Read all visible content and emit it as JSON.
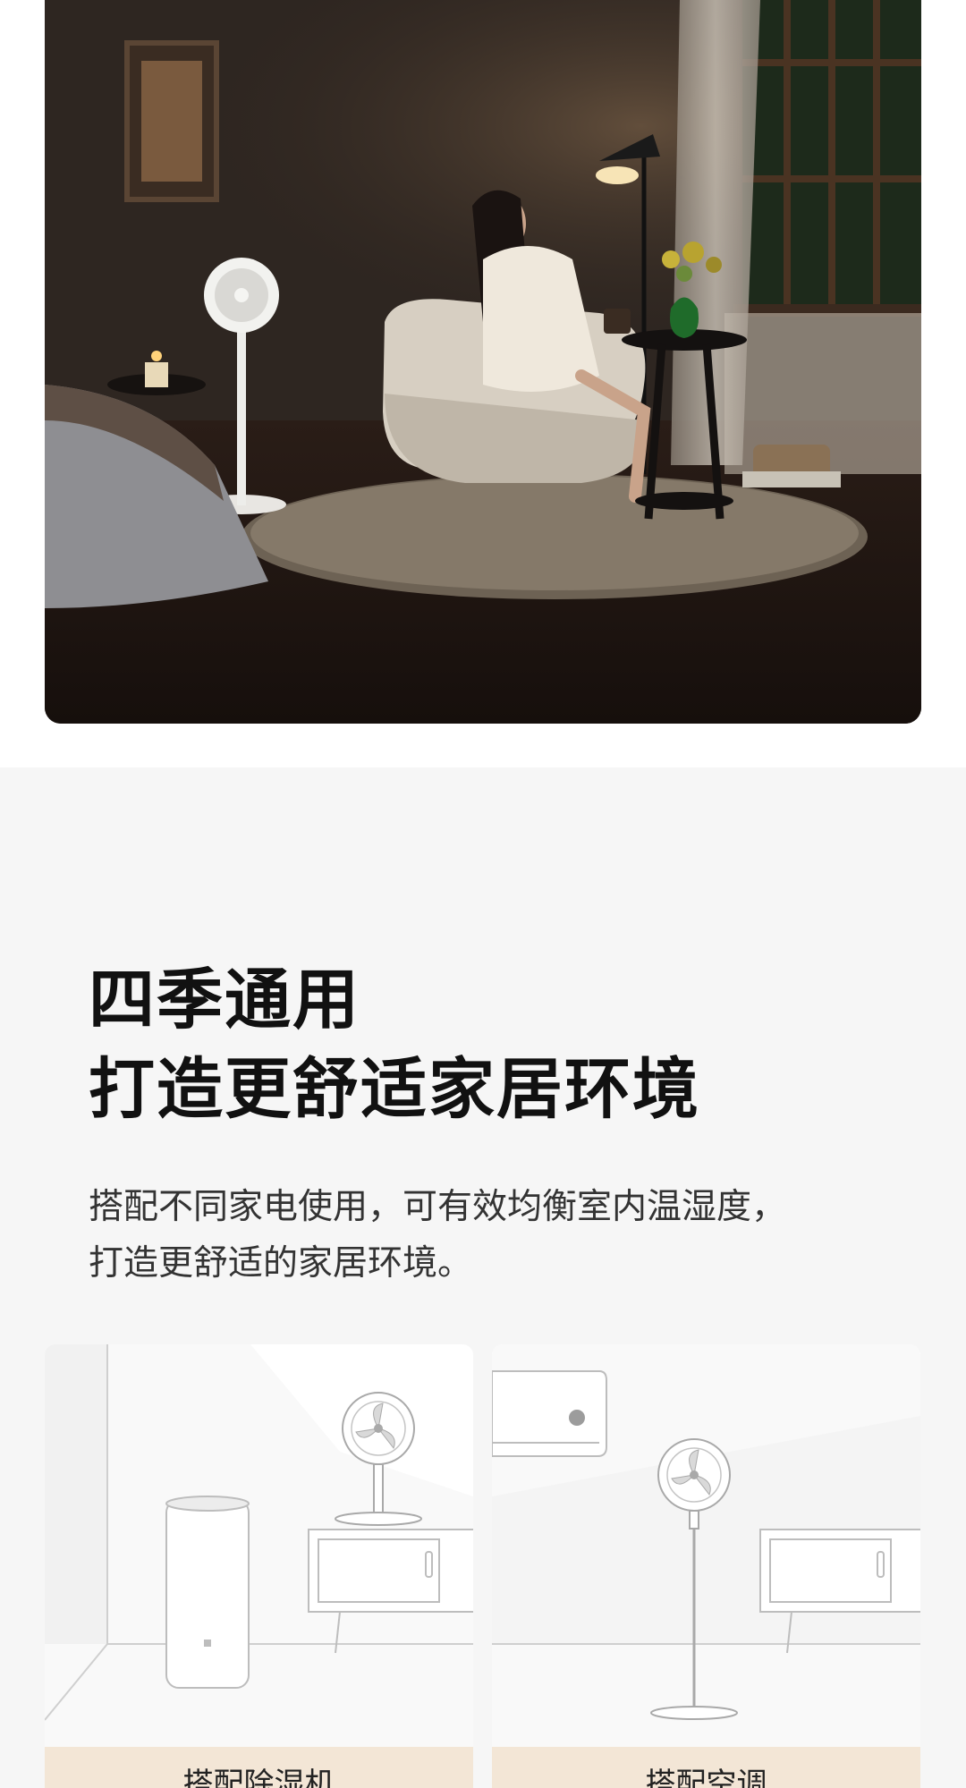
{
  "section": {
    "headline_line1": "四季通用",
    "headline_line2": "打造更舒适家居环境",
    "description_line1": "搭配不同家电使用，可有效均衡室内温湿度，",
    "description_line2": "打造更舒适的家居环境。"
  },
  "cards": [
    {
      "label": "搭配除湿机",
      "icon": "dehumidifier-icon"
    },
    {
      "label": "搭配空调",
      "icon": "air-conditioner-icon"
    }
  ],
  "colors": {
    "section_bg": "#f6f6f6",
    "card_label_bg": "#f3e6d6",
    "headline": "#111111",
    "body_text": "#333333"
  }
}
